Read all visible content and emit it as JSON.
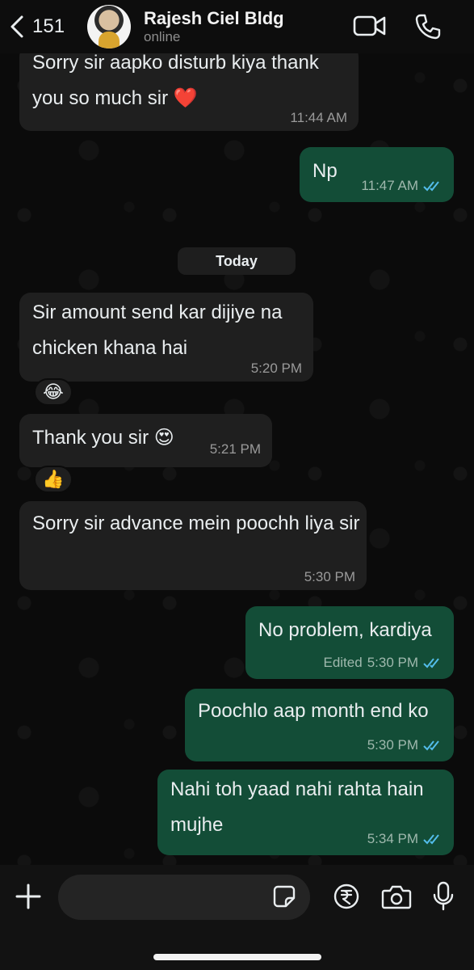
{
  "header": {
    "back_count": "151",
    "contact_name": "Rajesh Ciel Bldg",
    "status": "online"
  },
  "date_separator": "Today",
  "messages": [
    {
      "dir": "in",
      "text": "Sorry sir aapko disturb kiya thank you so much sir ❤️",
      "time": "11:44 AM"
    },
    {
      "dir": "out",
      "text": "Np",
      "time": "11:47 AM",
      "read": true
    },
    {
      "dir": "in",
      "text": "Sir amount send kar dijiye na chicken khana hai",
      "time": "5:20 PM",
      "reaction": "😂"
    },
    {
      "dir": "in",
      "text": "Thank you sir 😍",
      "time": "5:21 PM",
      "reaction": "👍"
    },
    {
      "dir": "in",
      "text": "Sorry sir advance mein poochh liya sir",
      "time": "5:30 PM"
    },
    {
      "dir": "out",
      "text": "No problem, kardiya",
      "time": "5:30 PM",
      "edited": "Edited",
      "read": true
    },
    {
      "dir": "out",
      "text": "Poochlo aap month end ko",
      "time": "5:30 PM",
      "read": true
    },
    {
      "dir": "out",
      "text": "Nahi toh yaad nahi rahta hain mujhe",
      "time": "5:34 PM",
      "read": true
    }
  ],
  "input": {
    "placeholder": "",
    "value": ""
  },
  "icons": {
    "back": "chevron-left-icon",
    "video": "video-camera-icon",
    "call": "phone-icon",
    "attach": "plus-icon",
    "sticker": "sticker-icon",
    "payment": "rupee-icon",
    "camera": "camera-icon",
    "voice": "microphone-icon"
  },
  "colors": {
    "incoming": "#1f1f1f",
    "outgoing": "#134d37",
    "read_ticks": "#53bdeb"
  }
}
